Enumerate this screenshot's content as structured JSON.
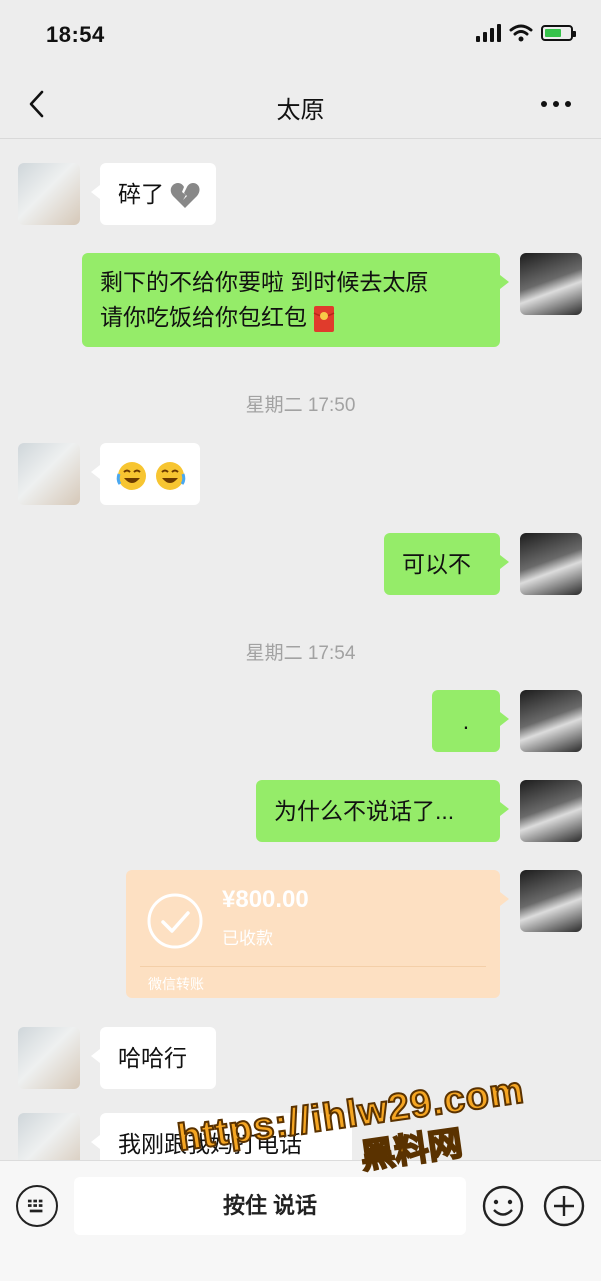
{
  "status_bar": {
    "time": "18:54"
  },
  "header": {
    "title": "太原"
  },
  "messages": [
    {
      "side": "in",
      "text": "碎了",
      "emoji": "broken-heart"
    },
    {
      "side": "out",
      "lines": [
        "剩下的不给你要啦 到时候去太原",
        "请你吃饭给你包红包"
      ],
      "emoji": "red-envelope"
    },
    {
      "type": "time",
      "text": "星期二 17:50"
    },
    {
      "side": "in",
      "emoji": "rolling-laughing x2"
    },
    {
      "side": "out",
      "text": "可以不"
    },
    {
      "type": "time",
      "text": "星期二 17:54"
    },
    {
      "side": "out",
      "text": "."
    },
    {
      "side": "out",
      "text": "为什么不说话了..."
    },
    {
      "side": "out",
      "type": "transfer",
      "amount": "¥800.00",
      "status": "已收款",
      "label": "微信转账"
    },
    {
      "side": "in",
      "text": "哈哈行"
    },
    {
      "side": "in",
      "text": "我刚跟我妈打电话"
    }
  ],
  "input_bar": {
    "hold_to_talk": "按住 说话"
  },
  "watermark": {
    "url": "https://ihlw29.com",
    "name": "黑料网"
  },
  "colors": {
    "outgoing_bubble": "#95ec69",
    "incoming_bubble": "#ffffff",
    "background": "#ededed",
    "transfer_card": "#fde0c2"
  }
}
